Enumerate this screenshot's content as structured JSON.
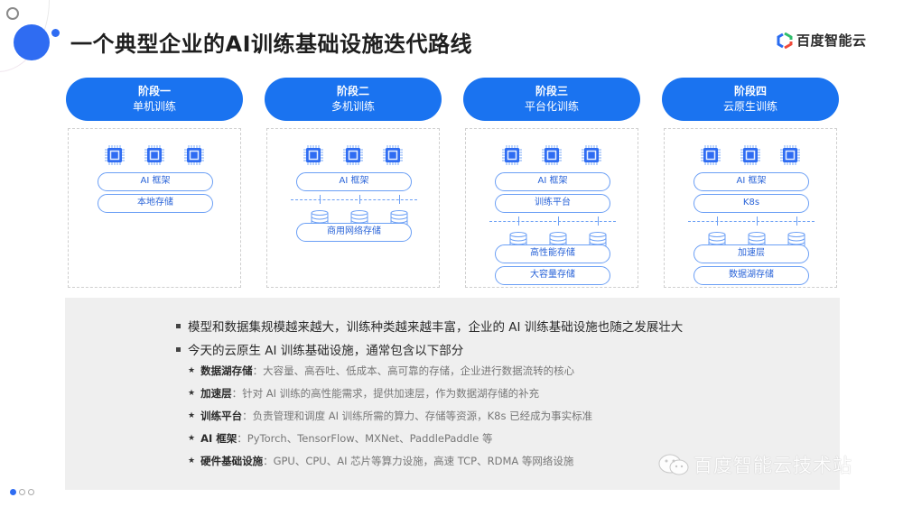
{
  "title": "一个典型企业的AI训练基础设施迭代路线",
  "logo": {
    "text": "百度智能云",
    "icon": "hexagon-logo-icon"
  },
  "colors": {
    "accent": "#1a73f0",
    "pill_border": "#6b9ff5",
    "pill_text": "#2a64d8",
    "info_bg": "#efefef"
  },
  "stages": [
    {
      "number": "阶段一",
      "name": "单机训练",
      "pills_top": [
        "AI 框架",
        "本地存储"
      ],
      "storage_pills": []
    },
    {
      "number": "阶段二",
      "name": "多机训练",
      "pills_top": [
        "AI 框架"
      ],
      "storage_pills": [
        "商用网络存储"
      ]
    },
    {
      "number": "阶段三",
      "name": "平台化训练",
      "pills_top": [
        "AI 框架",
        "训练平台"
      ],
      "storage_pills": [
        "高性能存储",
        "大容量存储"
      ]
    },
    {
      "number": "阶段四",
      "name": "云原生训练",
      "pills_top": [
        "AI 框架",
        "K8s"
      ],
      "storage_pills": [
        "加速层",
        "数据湖存储"
      ]
    }
  ],
  "bullets": [
    "模型和数据集规模越来越大，训练种类越来越丰富，企业的 AI 训练基础设施也随之发展壮大",
    "今天的云原生 AI 训练基础设施，通常包含以下部分"
  ],
  "sub_bullets": [
    {
      "term": "数据湖存储",
      "desc": "：大容量、高吞吐、低成本、高可靠的存储，企业进行数据流转的核心"
    },
    {
      "term": "加速层",
      "desc": "：针对 AI 训练的高性能需求，提供加速层，作为数据湖存储的补充"
    },
    {
      "term": "训练平台",
      "desc": "：负责管理和调度 AI 训练所需的算力、存储等资源，K8s 已经成为事实标准"
    },
    {
      "term": "AI 框架",
      "desc": "：PyTorch、TensorFlow、MXNet、PaddlePaddle 等"
    },
    {
      "term": "硬件基础设施",
      "desc": "：GPU、CPU、AI 芯片等算力设施，高速 TCP、RDMA 等网络设施"
    }
  ],
  "watermark": {
    "text": "百度智能云技术站",
    "icon": "wechat-icon"
  },
  "pager": {
    "current": 1,
    "total": 3
  }
}
